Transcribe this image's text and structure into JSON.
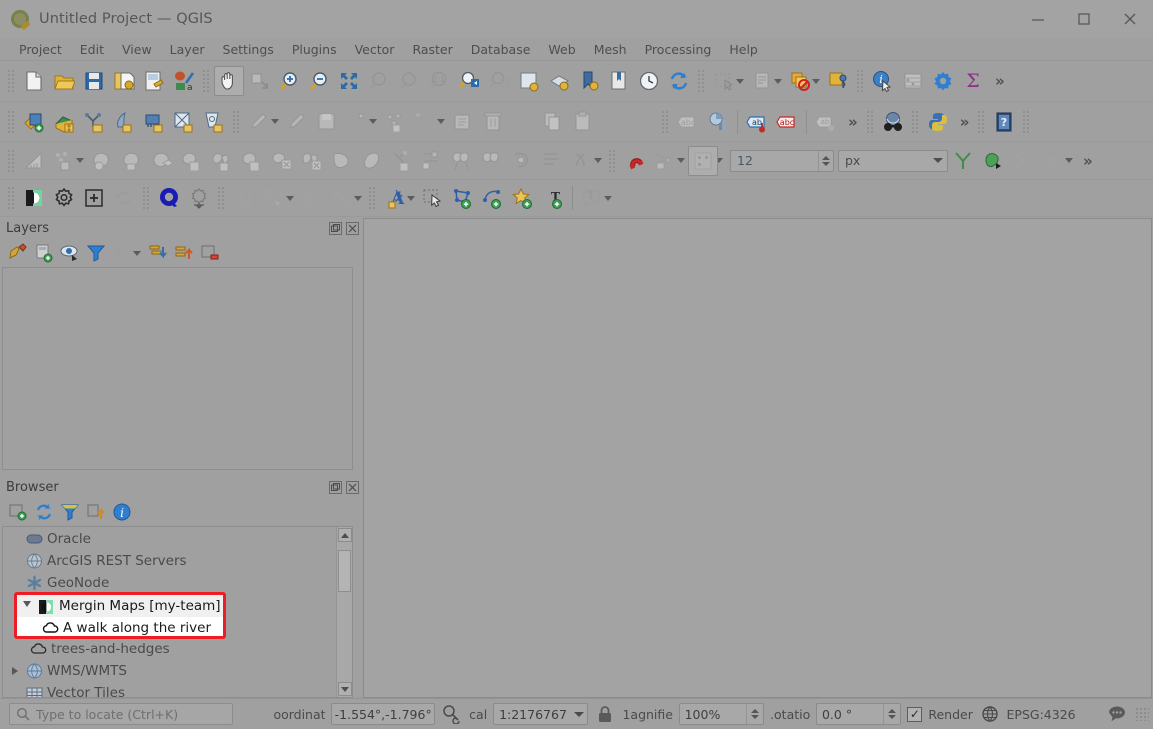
{
  "window": {
    "title": "Untitled Project — QGIS",
    "app_icon": "qgis-logo-icon",
    "minimize_label": "–",
    "maximize_label": "□",
    "close_label": "✕"
  },
  "menubar": {
    "items": [
      {
        "label": "Project",
        "mnemonic": "P"
      },
      {
        "label": "Edit",
        "mnemonic": "E"
      },
      {
        "label": "View",
        "mnemonic": "V"
      },
      {
        "label": "Layer",
        "mnemonic": "L"
      },
      {
        "label": "Settings",
        "mnemonic": "S"
      },
      {
        "label": "Plugins",
        "mnemonic": "P"
      },
      {
        "label": "Vector",
        "mnemonic": "o"
      },
      {
        "label": "Raster",
        "mnemonic": "R"
      },
      {
        "label": "Database",
        "mnemonic": "D"
      },
      {
        "label": "Web",
        "mnemonic": "W"
      },
      {
        "label": "Mesh",
        "mnemonic": "M"
      },
      {
        "label": "Processing",
        "mnemonic": "c"
      },
      {
        "label": "Help",
        "mnemonic": "H"
      }
    ]
  },
  "toolbars": {
    "row1": {
      "icons": [
        "new-project-icon",
        "open-project-icon",
        "save-project-icon",
        "save-project-as-icon",
        "new-print-layout-icon",
        "style-manager-icon",
        "pan-map-icon",
        "pan-to-selection-icon",
        "zoom-in-icon",
        "zoom-out-icon",
        "zoom-full-icon",
        "zoom-to-selection-icon",
        "zoom-to-layer-icon",
        "zoom-native-icon",
        "zoom-last-icon",
        "zoom-next-icon",
        "new-map-view-icon",
        "new-3d-map-view-icon",
        "show-bookmarks-icon",
        "new-bookmark-icon",
        "temporal-controller-icon",
        "refresh-icon",
        "select-features-icon",
        "deselect-icon",
        "select-by-expression-icon",
        "clear-selection-icon",
        "identify-features-icon",
        "statistical-summary-icon",
        "options-icon",
        "sum-icon"
      ],
      "overflow_label": "»"
    },
    "row2": {
      "icons": [
        "add-vector-layer-icon",
        "add-raster-layer-icon",
        "add-delimited-text-layer-icon",
        "add-spatialite-layer-icon",
        "add-postgis-layer-icon",
        "add-wms-layer-icon",
        "add-mesh-layer-icon",
        "toggle-editing-icon",
        "edit-pencil-icon",
        "save-layer-edits-icon",
        "add-line-feature-icon",
        "add-point-feature-icon",
        "vertex-tool-icon",
        "modify-attributes-icon",
        "delete-selected-icon",
        "cut-features-icon",
        "copy-features-icon",
        "paste-features-icon",
        "undo-icon",
        "redo-icon",
        "label-icon",
        "diagram-icon",
        "pin-labels-icon",
        "show-hide-labels-icon",
        "move-label-icon",
        "python-console-icon",
        "help-icon"
      ],
      "overflow_label": "»"
    },
    "row3": {
      "icons": [
        "measure-line-icon",
        "measure-area-icon",
        "multi-part-icon",
        "rotate-feature-icon",
        "simplify-feature-icon",
        "add-ring-icon",
        "add-part-icon",
        "fill-ring-icon",
        "delete-ring-icon",
        "delete-part-icon",
        "reshape-features-icon",
        "offset-curve-icon",
        "split-features-icon",
        "split-parts-icon",
        "merge-features-icon",
        "merge-attributes-icon",
        "rotate-point-symbols-icon",
        "offset-point-symbol-icon",
        "snapping-magnet-icon",
        "snapping-options-icon",
        "snapping-mode-icon"
      ],
      "tolerance_value": "12",
      "tolerance_unit": "px",
      "trailing_icons": [
        "topological-editing-icon",
        "avoid-overlap-icon",
        "enable-snap-icon",
        "enable-intersection-snap-icon"
      ],
      "overflow_label": "»"
    },
    "row4": {
      "icons": [
        "mergin-maps-icon",
        "mergin-settings-icon",
        "mergin-create-project-icon",
        "mergin-sync-icon",
        "qfield-icon",
        "qfield-package-icon",
        "layout-manager-icon",
        "layout-designer-icon",
        "atlas-icon",
        "report-icon",
        "annotation-text-icon",
        "select-annotation-icon",
        "polygon-annotation-icon",
        "line-annotation-icon",
        "marker-annotation-icon",
        "text-annotation-icon",
        "html-annotation-icon"
      ]
    }
  },
  "layers_panel": {
    "title": "Layers",
    "float_label": "❐",
    "close_label": "✕",
    "toolbar_icons": [
      "open-layer-styling-panel-icon",
      "add-group-icon",
      "manage-layer-visibility-icon",
      "filter-legend-icon",
      "filter-legend-expression-icon",
      "expand-all-icon",
      "collapse-all-icon",
      "remove-layer-icon"
    ],
    "items": []
  },
  "browser_panel": {
    "title": "Browser",
    "float_label": "❐",
    "close_label": "✕",
    "toolbar_icons": [
      "add-selected-layers-icon",
      "refresh-icon",
      "filter-browser-icon",
      "collapse-all-icon",
      "properties-icon"
    ],
    "tree": [
      {
        "label": "Oracle",
        "icon": "oracle-icon",
        "indent": 1,
        "expander": "none"
      },
      {
        "label": "ArcGIS REST Servers",
        "icon": "arcgis-globe-icon",
        "indent": 1,
        "expander": "none"
      },
      {
        "label": "GeoNode",
        "icon": "geonode-icon",
        "indent": 1,
        "expander": "none"
      },
      {
        "label": "trees-and-hedges",
        "icon": "cloud-project-icon",
        "indent": 2,
        "expander": "none"
      },
      {
        "label": "WMS/WMTS",
        "icon": "wms-globe-icon",
        "indent": 1,
        "expander": "collapsed"
      },
      {
        "label": "Vector Tiles",
        "icon": "vector-tiles-icon",
        "indent": 1,
        "expander": "none"
      }
    ],
    "highlight": {
      "border_color": "#ee1c25",
      "rows": [
        {
          "label": "Mergin Maps [my-team]",
          "icon": "mergin-maps-icon",
          "expander": "expanded",
          "selected": true
        },
        {
          "label": "A walk along the river",
          "icon": "cloud-project-icon",
          "expander": "none",
          "selected": false
        }
      ]
    },
    "scrollbar": {
      "up_label": "▲",
      "down_label": "▼"
    }
  },
  "statusbar": {
    "locator_placeholder": "Type to locate (Ctrl+K)",
    "locator_icon": "search-icon",
    "coordinate_label": "oordinat",
    "coordinate_value": "-1.554°,-1.796°",
    "coordinate_toggle_icon": "toggle-extents-icon",
    "scale_label": "cal",
    "scale_value": "1:2176767",
    "scale_lock_icon": "lock-icon",
    "magnifier_label": "1agnifie",
    "magnifier_value": "100%",
    "rotation_label": ".otatio",
    "rotation_value": "0.0 °",
    "render_label": "Render",
    "render_checked": true,
    "crs_label": "EPSG:4326",
    "crs_icon": "globe-icon",
    "messages_icon": "messages-icon"
  }
}
